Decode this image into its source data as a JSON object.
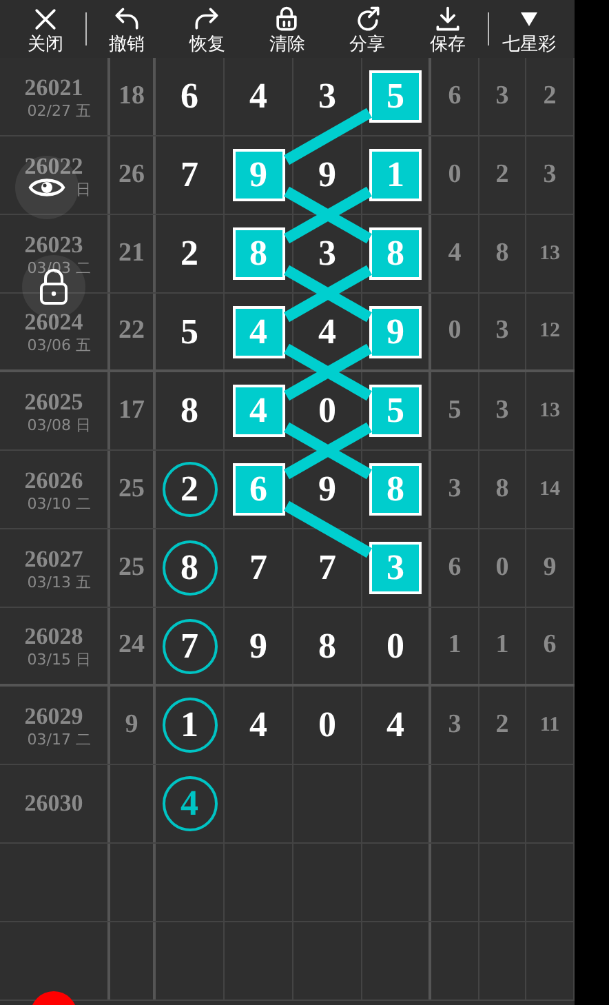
{
  "toolbar": [
    {
      "label": "关闭",
      "kind": "close",
      "divider_after": true
    },
    {
      "label": "撤销",
      "kind": "undo",
      "divider_after": false
    },
    {
      "label": "恢复",
      "kind": "redo",
      "divider_after": false
    },
    {
      "label": "清除",
      "kind": "clear",
      "divider_after": false
    },
    {
      "label": "分享",
      "kind": "share",
      "divider_after": false
    },
    {
      "label": "保存",
      "kind": "save",
      "divider_after": true
    },
    {
      "label": "七星彩",
      "kind": "menu",
      "divider_after": false
    }
  ],
  "rows": [
    {
      "issue": "26021",
      "date": "02/27 五",
      "sum": "18",
      "digits": [
        {
          "value": "6",
          "kind": "plain"
        },
        {
          "value": "4",
          "kind": "plain"
        },
        {
          "value": "3",
          "kind": "plain"
        },
        {
          "value": "5",
          "kind": "square"
        }
      ],
      "extra": [
        "6",
        "3",
        "2"
      ],
      "divider_below": false
    },
    {
      "issue": "26022",
      "date": "日",
      "sum": "26",
      "digits": [
        {
          "value": "7",
          "kind": "plain"
        },
        {
          "value": "9",
          "kind": "square"
        },
        {
          "value": "9",
          "kind": "plain"
        },
        {
          "value": "1",
          "kind": "square"
        }
      ],
      "extra": [
        "0",
        "2",
        "3"
      ],
      "divider_below": false
    },
    {
      "issue": "26023",
      "date": "03/03 二",
      "sum": "21",
      "digits": [
        {
          "value": "2",
          "kind": "plain"
        },
        {
          "value": "8",
          "kind": "square"
        },
        {
          "value": "3",
          "kind": "plain"
        },
        {
          "value": "8",
          "kind": "square"
        }
      ],
      "extra": [
        "4",
        "8",
        "13"
      ],
      "divider_below": false
    },
    {
      "issue": "26024",
      "date": "03/06 五",
      "sum": "22",
      "digits": [
        {
          "value": "5",
          "kind": "plain"
        },
        {
          "value": "4",
          "kind": "square"
        },
        {
          "value": "4",
          "kind": "plain"
        },
        {
          "value": "9",
          "kind": "square"
        }
      ],
      "extra": [
        "0",
        "3",
        "12"
      ],
      "divider_below": true
    },
    {
      "issue": "26025",
      "date": "03/08 日",
      "sum": "17",
      "digits": [
        {
          "value": "8",
          "kind": "plain"
        },
        {
          "value": "4",
          "kind": "square"
        },
        {
          "value": "0",
          "kind": "plain"
        },
        {
          "value": "5",
          "kind": "square"
        }
      ],
      "extra": [
        "5",
        "3",
        "13"
      ],
      "divider_below": false
    },
    {
      "issue": "26026",
      "date": "03/10 二",
      "sum": "25",
      "digits": [
        {
          "value": "2",
          "kind": "circle"
        },
        {
          "value": "6",
          "kind": "square"
        },
        {
          "value": "9",
          "kind": "plain"
        },
        {
          "value": "8",
          "kind": "square"
        }
      ],
      "extra": [
        "3",
        "8",
        "14"
      ],
      "divider_below": false
    },
    {
      "issue": "26027",
      "date": "03/13 五",
      "sum": "25",
      "digits": [
        {
          "value": "8",
          "kind": "circle"
        },
        {
          "value": "7",
          "kind": "plain"
        },
        {
          "value": "7",
          "kind": "plain"
        },
        {
          "value": "3",
          "kind": "square"
        }
      ],
      "extra": [
        "6",
        "0",
        "9"
      ],
      "divider_below": false
    },
    {
      "issue": "26028",
      "date": "03/15 日",
      "sum": "24",
      "digits": [
        {
          "value": "7",
          "kind": "circle"
        },
        {
          "value": "9",
          "kind": "plain"
        },
        {
          "value": "8",
          "kind": "plain"
        },
        {
          "value": "0",
          "kind": "plain"
        }
      ],
      "extra": [
        "1",
        "1",
        "6"
      ],
      "divider_below": true
    },
    {
      "issue": "26029",
      "date": "03/17 二",
      "sum": "9",
      "digits": [
        {
          "value": "1",
          "kind": "circle"
        },
        {
          "value": "4",
          "kind": "plain"
        },
        {
          "value": "0",
          "kind": "plain"
        },
        {
          "value": "4",
          "kind": "plain"
        }
      ],
      "extra": [
        "3",
        "2",
        "11"
      ],
      "divider_below": false
    },
    {
      "issue": "26030",
      "digits": [
        {
          "value": "4",
          "kind": "forecast"
        }
      ],
      "extra": [],
      "divider_below": false
    }
  ]
}
